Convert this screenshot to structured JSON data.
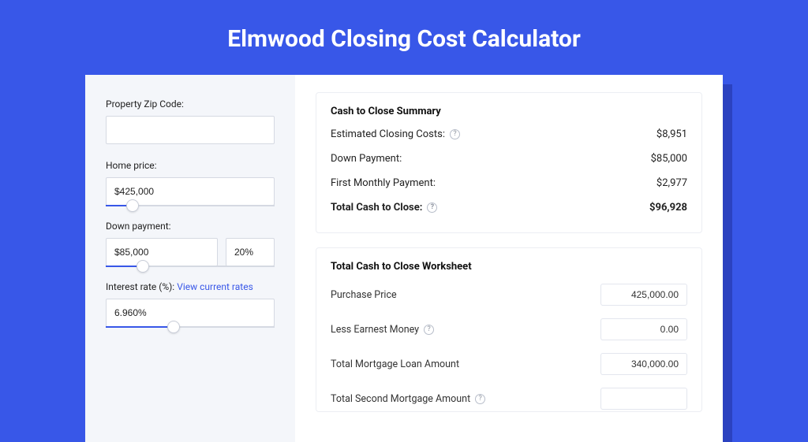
{
  "hero": {
    "title": "Elmwood Closing Cost Calculator"
  },
  "sidebar": {
    "zip_label": "Property Zip Code:",
    "zip_value": "",
    "home_price_label": "Home price:",
    "home_price_value": "$425,000",
    "home_price_fill_pct": "16%",
    "down_payment_label": "Down payment:",
    "down_payment_value": "$85,000",
    "down_payment_pct": "20%",
    "down_payment_fill_pct": "22%",
    "interest_label": "Interest rate (%):",
    "interest_link": "View current rates",
    "interest_value": "6.960%",
    "interest_fill_pct": "40%"
  },
  "summary": {
    "title": "Cash to Close Summary",
    "rows": {
      "est_costs_label": "Estimated Closing Costs:",
      "est_costs_value": "$8,951",
      "down_label": "Down Payment:",
      "down_value": "$85,000",
      "first_label": "First Monthly Payment:",
      "first_value": "$2,977",
      "total_label": "Total Cash to Close:",
      "total_value": "$96,928"
    }
  },
  "worksheet": {
    "title": "Total Cash to Close Worksheet",
    "rows": {
      "purchase_label": "Purchase Price",
      "purchase_value": "425,000.00",
      "earnest_label": "Less Earnest Money",
      "earnest_value": "0.00",
      "loan_label": "Total Mortgage Loan Amount",
      "loan_value": "340,000.00",
      "second_label": "Total Second Mortgage Amount"
    }
  }
}
